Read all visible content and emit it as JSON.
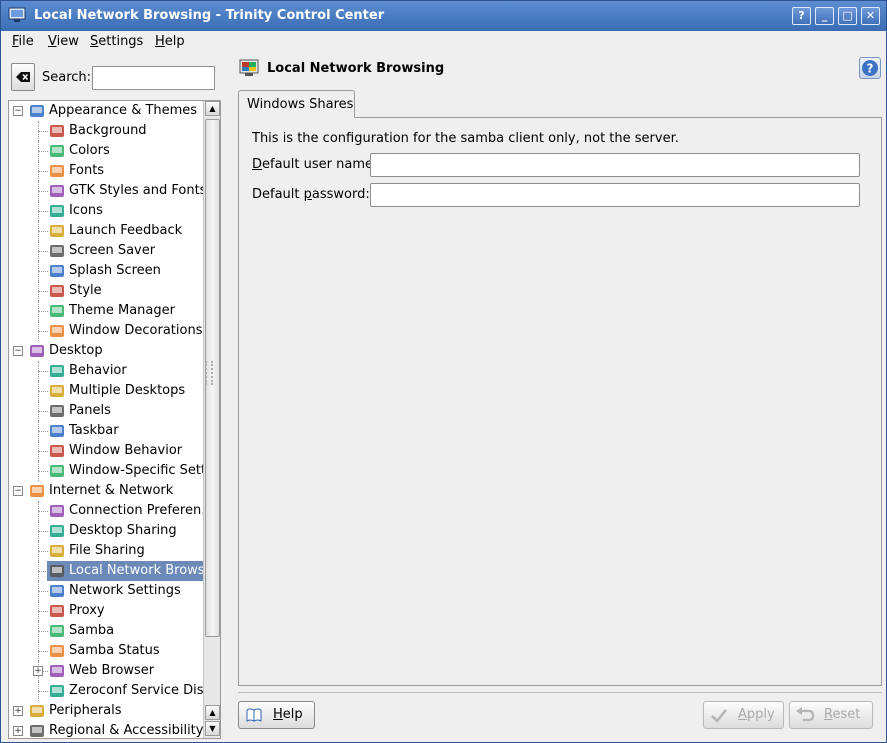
{
  "window": {
    "title": "Local Network Browsing - Trinity Control Center",
    "buttons": [
      "?",
      "_",
      "□",
      "✕"
    ]
  },
  "menu": [
    {
      "label": "File",
      "mnemonic": "F",
      "rest": "ile"
    },
    {
      "label": "View",
      "mnemonic": "V",
      "rest": "iew"
    },
    {
      "label": "Settings",
      "mnemonic": "S",
      "rest": "ettings"
    },
    {
      "label": "Help",
      "mnemonic": "H",
      "rest": "elp"
    }
  ],
  "search": {
    "label": "Search:",
    "value": ""
  },
  "tree": [
    {
      "label": "Appearance & Themes",
      "level": 0,
      "expanded": true
    },
    {
      "label": "Background",
      "level": 1
    },
    {
      "label": "Colors",
      "level": 1
    },
    {
      "label": "Fonts",
      "level": 1
    },
    {
      "label": "GTK Styles and Fonts",
      "level": 1
    },
    {
      "label": "Icons",
      "level": 1
    },
    {
      "label": "Launch Feedback",
      "level": 1
    },
    {
      "label": "Screen Saver",
      "level": 1
    },
    {
      "label": "Splash Screen",
      "level": 1
    },
    {
      "label": "Style",
      "level": 1
    },
    {
      "label": "Theme Manager",
      "level": 1
    },
    {
      "label": "Window Decorations",
      "level": 1
    },
    {
      "label": "Desktop",
      "level": 0,
      "expanded": true
    },
    {
      "label": "Behavior",
      "level": 1
    },
    {
      "label": "Multiple Desktops",
      "level": 1
    },
    {
      "label": "Panels",
      "level": 1
    },
    {
      "label": "Taskbar",
      "level": 1
    },
    {
      "label": "Window Behavior",
      "level": 1
    },
    {
      "label": "Window-Specific Sett…",
      "level": 1
    },
    {
      "label": "Internet & Network",
      "level": 0,
      "expanded": true
    },
    {
      "label": "Connection Preferen…",
      "level": 1
    },
    {
      "label": "Desktop Sharing",
      "level": 1
    },
    {
      "label": "File Sharing",
      "level": 1
    },
    {
      "label": "Local Network Brows…",
      "level": 1,
      "selected": true
    },
    {
      "label": "Network Settings",
      "level": 1
    },
    {
      "label": "Proxy",
      "level": 1
    },
    {
      "label": "Samba",
      "level": 1
    },
    {
      "label": "Samba Status",
      "level": 1
    },
    {
      "label": "Web Browser",
      "level": 1,
      "expandable": true
    },
    {
      "label": "Zeroconf Service Disc…",
      "level": 1
    },
    {
      "label": "Peripherals",
      "level": 0,
      "expanded": false
    },
    {
      "label": "Regional & Accessibility",
      "level": 0,
      "expanded": false
    }
  ],
  "module": {
    "title": "Local Network Browsing"
  },
  "tab": {
    "label": "Windows Shares"
  },
  "content": {
    "info": "This is the configuration for the samba client only, not the server.",
    "user_label_m": "D",
    "user_label_rest": "efault user name:",
    "user_value": "",
    "pass_label_pre": "Default ",
    "pass_label_m": "p",
    "pass_label_rest": "assword:",
    "pass_value": ""
  },
  "buttons": {
    "help": "Help",
    "help_m": "H",
    "help_rest": "elp",
    "apply": "Apply",
    "apply_m": "A",
    "apply_rest": "pply",
    "reset": "Reset",
    "reset_m": "R",
    "reset_rest": "eset"
  },
  "colors": {
    "titlebar": "#3a6db5",
    "selection": "#6b8ab8",
    "background": "#efefef"
  }
}
